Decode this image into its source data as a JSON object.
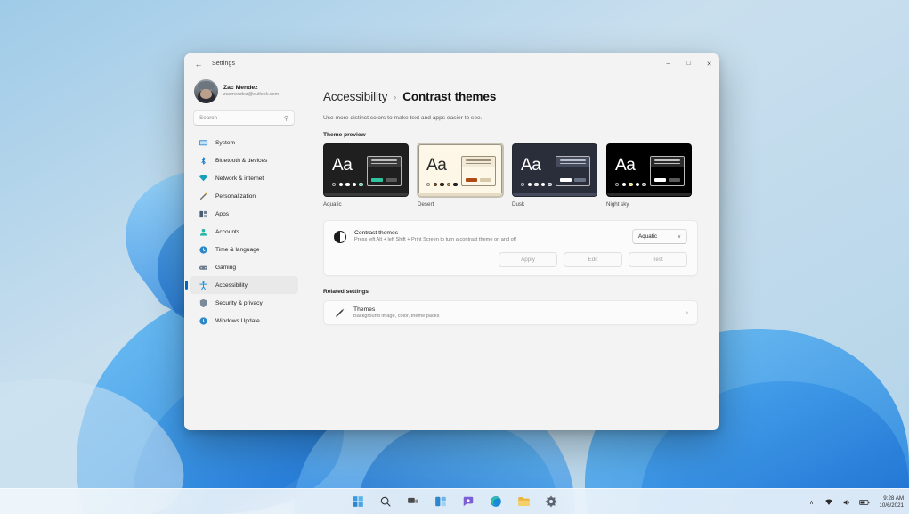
{
  "window": {
    "title": "Settings",
    "back_icon": "back-arrow-icon",
    "controls": {
      "minimize": "–",
      "maximize": "□",
      "close": "✕"
    }
  },
  "profile": {
    "name": "Zac Mendez",
    "email": "zacmendez@outlook.com",
    "avatar_name": "user-avatar"
  },
  "search": {
    "placeholder": "Search",
    "icon": "search-icon"
  },
  "sidebar": {
    "items": [
      {
        "label": "System",
        "icon": "system-icon",
        "color": "#3f8fd0",
        "active": false
      },
      {
        "label": "Bluetooth & devices",
        "icon": "bluetooth-icon",
        "color": "#1a7fd4",
        "active": false
      },
      {
        "label": "Network & internet",
        "icon": "network-icon",
        "color": "#17a0b8",
        "active": false
      },
      {
        "label": "Personalization",
        "icon": "personalization-brush-icon",
        "color": "#c9a227",
        "active": false
      },
      {
        "label": "Apps",
        "icon": "apps-icon",
        "color": "#4a5d73",
        "active": false
      },
      {
        "label": "Accounts",
        "icon": "accounts-icon",
        "color": "#2bb6a6",
        "active": false
      },
      {
        "label": "Time & language",
        "icon": "time-language-icon",
        "color": "#2b87c9",
        "active": false
      },
      {
        "label": "Gaming",
        "icon": "gaming-controller-icon",
        "color": "#6b7a8c",
        "active": false
      },
      {
        "label": "Accessibility",
        "icon": "accessibility-person-icon",
        "color": "#1e90d6",
        "active": true
      },
      {
        "label": "Security & privacy",
        "icon": "shield-icon",
        "color": "#7b8a99",
        "active": false
      },
      {
        "label": "Windows Update",
        "icon": "windows-update-icon",
        "color": "#2b87c9",
        "active": false
      }
    ]
  },
  "breadcrumb": {
    "parent": "Accessibility",
    "separator": "›",
    "current": "Contrast themes"
  },
  "page": {
    "description": "Use more distinct colors to make text and apps easier to see.",
    "theme_preview_label": "Theme preview",
    "related_settings_label": "Related settings"
  },
  "theme_cards": [
    {
      "name": "Aquatic",
      "selected": false,
      "bg": "#1f1f1f",
      "text_color": "#ffffff",
      "dots": [
        "#1f1f1f",
        "#ffffff",
        "#ffffff",
        "#ffffff",
        "#2fc4a0"
      ],
      "window_bg": "#1f1f1f",
      "window_bar": "#3a3a3a",
      "line_color": "#bdbdbd",
      "btn_primary": "#2fc4a0",
      "btn_secondary": "#5a5a5a",
      "strip": "#3a3a3a"
    },
    {
      "name": "Desert",
      "selected": true,
      "bg": "#fdf7e8",
      "text_color": "#2b2b2b",
      "dots": [
        "#fdf7e8",
        "#8a5a2b",
        "#3a2a1a",
        "#caa26a",
        "#2b2b2b"
      ],
      "window_bg": "#fdf7e8",
      "window_bar": "#f2ead6",
      "line_color": "#9a8e74",
      "btn_primary": "#b04a14",
      "btn_secondary": "#d8c9a8",
      "strip": "#e6dcc4"
    },
    {
      "name": "Dusk",
      "selected": false,
      "bg": "#2a2e3a",
      "text_color": "#ffffff",
      "dots": [
        "#2a2e3a",
        "#ffffff",
        "#dcdcdc",
        "#ffffff",
        "#9aa4b4"
      ],
      "window_bg": "#2a2e3a",
      "window_bar": "#454b5c",
      "line_color": "#b9bfcc",
      "btn_primary": "#ffffff",
      "btn_secondary": "#6a7285",
      "strip": "#454b5c"
    },
    {
      "name": "Night sky",
      "selected": false,
      "bg": "#000000",
      "text_color": "#ffffff",
      "dots": [
        "#000000",
        "#ffffff",
        "#e8e04a",
        "#ffffff",
        "#8a8a8a"
      ],
      "window_bg": "#000000",
      "window_bar": "#2a2a2a",
      "line_color": "#c4c4c4",
      "btn_primary": "#ffffff",
      "btn_secondary": "#5a5a5a",
      "strip": "#2a2a2a"
    }
  ],
  "contrast_setting": {
    "icon": "contrast-circle-icon",
    "title": "Contrast themes",
    "subtitle": "Press left Alt + left Shift + Print Screen to turn a contrast theme on and off",
    "selected_theme": "Aquatic",
    "chevron": "∨",
    "buttons": [
      {
        "label": "Apply",
        "name": "apply-button"
      },
      {
        "label": "Edit",
        "name": "edit-button"
      },
      {
        "label": "Test",
        "name": "test-button"
      }
    ]
  },
  "related_settings": {
    "icon": "themes-brush-icon",
    "title": "Themes",
    "subtitle": "Background image, color, theme packs",
    "chevron": "›"
  },
  "taskbar": {
    "icons": [
      {
        "name": "start-icon",
        "label": "Start"
      },
      {
        "name": "search-icon",
        "label": "Search"
      },
      {
        "name": "task-view-icon",
        "label": "Task View"
      },
      {
        "name": "widgets-icon",
        "label": "Widgets"
      },
      {
        "name": "chat-icon",
        "label": "Chat"
      },
      {
        "name": "edge-icon",
        "label": "Microsoft Edge"
      },
      {
        "name": "file-explorer-icon",
        "label": "File Explorer"
      },
      {
        "name": "settings-icon",
        "label": "Settings"
      }
    ],
    "tray": {
      "chevron": "∧",
      "wifi": "wifi-icon",
      "volume": "volume-icon",
      "battery": "battery-icon",
      "time": "9:28 AM",
      "date": "10/6/2021"
    }
  }
}
